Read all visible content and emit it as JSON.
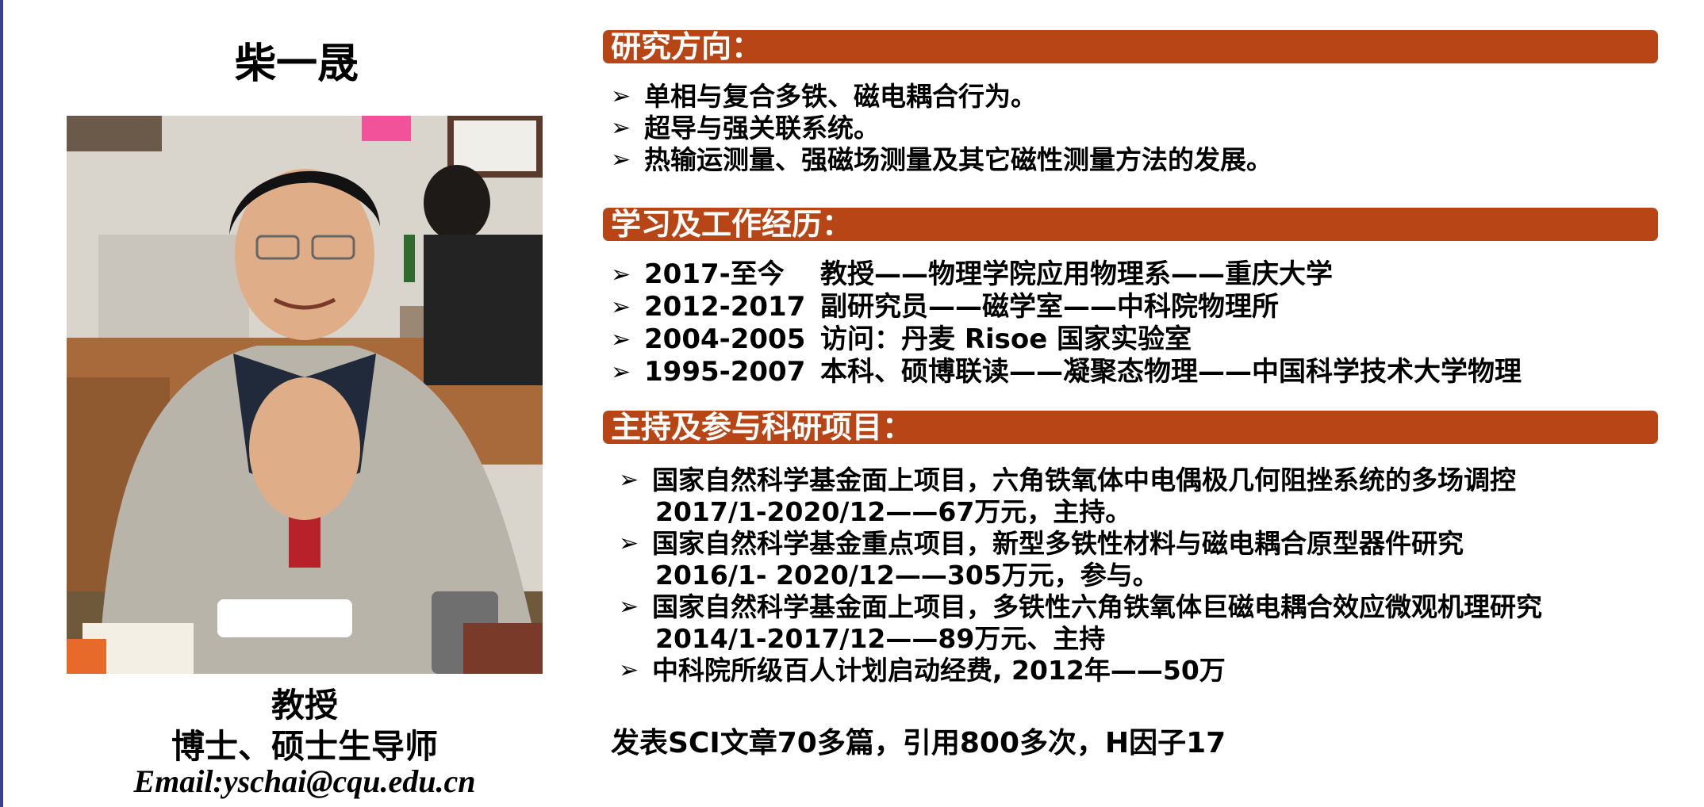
{
  "profile": {
    "name": "柴一晟",
    "title": "教授",
    "degree": "博士、硕士生导师",
    "email": "Email:yschai@cqu.edu.cn"
  },
  "sections": {
    "research": {
      "heading": "研究方向：",
      "items": [
        "单相与复合多铁、磁电耦合行为。",
        "超导与强关联系统。",
        "热输运测量、强磁场测量及其它磁性测量方法的发展。"
      ]
    },
    "career": {
      "heading": "学习及工作经历：",
      "items": [
        {
          "years": "2017-至今",
          "text": "教授——物理学院应用物理系——重庆大学"
        },
        {
          "years": "2012-2017",
          "text": "副研究员——磁学室——中科院物理所"
        },
        {
          "years": "2004-2005",
          "text": "访问：丹麦 Risoe 国家实验室"
        },
        {
          "years": "1995-2007",
          "text": "本科、硕博联读——凝聚态物理——中国科学技术大学物理"
        }
      ]
    },
    "projects": {
      "heading": "主持及参与科研项目：",
      "items": [
        {
          "title": "国家自然科学基金面上项目，六角铁氧体中电偶极几何阻挫系统的多场调控",
          "detail": "2017/1-2020/12——67万元，主持。"
        },
        {
          "title": "国家自然科学基金重点项目，新型多铁性材料与磁电耦合原型器件研究",
          "detail": "2016/1- 2020/12——305万元，参与。"
        },
        {
          "title": "国家自然科学基金面上项目，多铁性六角铁氧体巨磁电耦合效应微观机理研究",
          "detail": "2014/1-2017/12——89万元、主持"
        },
        {
          "title": "中科院所级百人计划启动经费, 2012年——50万",
          "detail": ""
        }
      ]
    }
  },
  "summary": "发表SCI文章70多篇，引用800多次，H因子17",
  "colors": {
    "section_bar": "#b84515",
    "left_rule": "#3a3f8f"
  },
  "icons": {
    "bullet": "arrow-bullet-icon"
  }
}
